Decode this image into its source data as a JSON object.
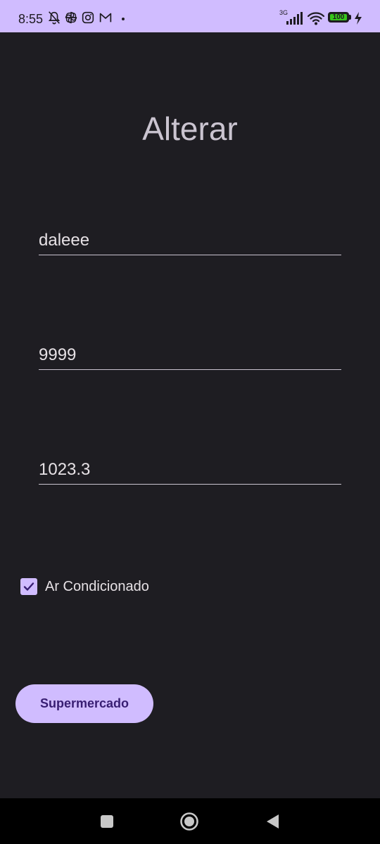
{
  "status_bar": {
    "time": "8:55",
    "network_type": "3G",
    "battery_percent": "100",
    "battery_level": 1.0,
    "icons": [
      "notifications-off-icon",
      "pinwheel-icon",
      "instagram-icon",
      "gmail-icon",
      "dot-icon",
      "signal-icon",
      "wifi-icon",
      "battery-icon",
      "charging-icon"
    ],
    "background_color": "#d0bcff"
  },
  "page": {
    "title": "Alterar",
    "background_color": "#1e1d22"
  },
  "form": {
    "fields": [
      {
        "value": "daleee"
      },
      {
        "value": "9999"
      },
      {
        "value": "1023.3"
      }
    ],
    "checkbox": {
      "label": "Ar Condicionado",
      "checked": true
    },
    "button_label": "Supermercado",
    "accent_color": "#d0bcff"
  },
  "nav_bar": {
    "buttons": [
      "recents-square-icon",
      "home-circle-icon",
      "back-triangle-icon"
    ]
  }
}
